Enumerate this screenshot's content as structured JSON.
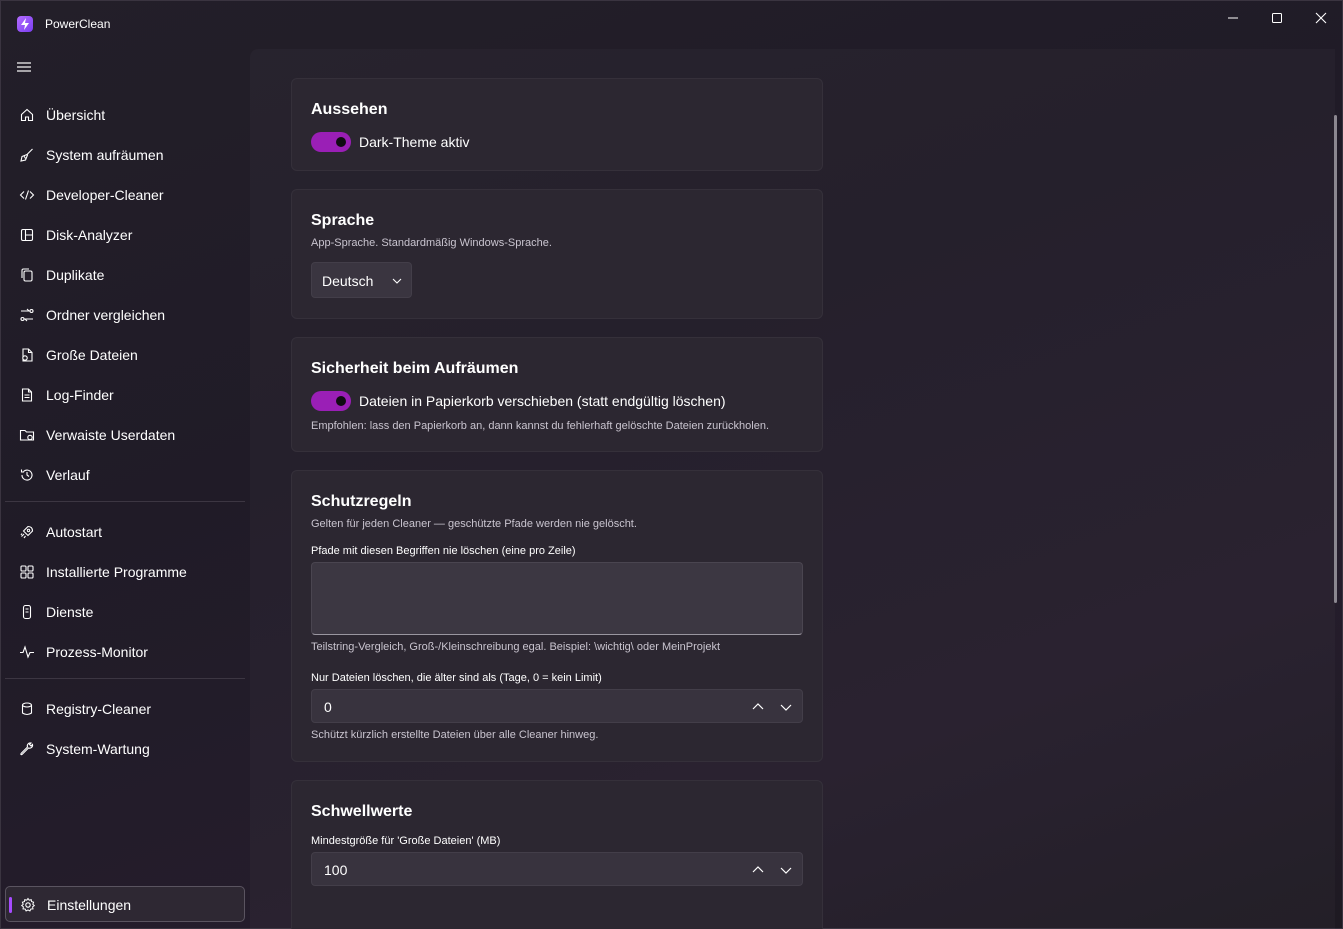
{
  "app": {
    "title": "PowerClean"
  },
  "window_controls": [
    "minimize-icon",
    "maximize-icon",
    "close-icon"
  ],
  "sidebar": {
    "menu_icon": "hamburger-icon",
    "groups": [
      [
        {
          "label": "Übersicht",
          "icon": "home-icon"
        },
        {
          "label": "System aufräumen",
          "icon": "broom-icon"
        },
        {
          "label": "Developer-Cleaner",
          "icon": "code-icon"
        },
        {
          "label": "Disk-Analyzer",
          "icon": "disk-layout-icon"
        },
        {
          "label": "Duplikate",
          "icon": "copy-icon"
        },
        {
          "label": "Ordner vergleichen",
          "icon": "compare-icon"
        },
        {
          "label": "Große Dateien",
          "icon": "large-file-icon"
        },
        {
          "label": "Log-Finder",
          "icon": "document-icon"
        },
        {
          "label": "Verwaiste Userdaten",
          "icon": "folder-icon"
        },
        {
          "label": "Verlauf",
          "icon": "history-icon"
        }
      ],
      [
        {
          "label": "Autostart",
          "icon": "rocket-icon"
        },
        {
          "label": "Installierte Programme",
          "icon": "apps-icon"
        },
        {
          "label": "Dienste",
          "icon": "service-icon"
        },
        {
          "label": "Prozess-Monitor",
          "icon": "pulse-icon"
        }
      ],
      [
        {
          "label": "Registry-Cleaner",
          "icon": "database-icon"
        },
        {
          "label": "System-Wartung",
          "icon": "wrench-icon"
        }
      ]
    ],
    "footer": {
      "label": "Einstellungen",
      "icon": "gear-icon",
      "selected": true
    }
  },
  "settings": {
    "appearance": {
      "title": "Aussehen",
      "dark_theme_label": "Dark-Theme aktiv",
      "dark_theme_on": true
    },
    "language": {
      "title": "Sprache",
      "subtitle": "App-Sprache. Standardmäßig Windows-Sprache.",
      "selected": "Deutsch"
    },
    "safety": {
      "title": "Sicherheit beim Aufräumen",
      "recycle_label": "Dateien in Papierkorb verschieben (statt endgültig löschen)",
      "recycle_on": true,
      "hint": "Empfohlen: lass den Papierkorb an, dann kannst du fehlerhaft gelöschte Dateien zurückholen."
    },
    "protection": {
      "title": "Schutzregeln",
      "subtitle": "Gelten für jeden Cleaner — geschützte Pfade werden nie gelöscht.",
      "paths_label": "Pfade mit diesen Begriffen nie löschen (eine pro Zeile)",
      "paths_value": "",
      "paths_hint": "Teilstring-Vergleich, Groß-/Kleinschreibung egal. Beispiel: \\wichtig\\ oder MeinProjekt",
      "age_label": "Nur Dateien löschen, die älter sind als (Tage, 0 = kein Limit)",
      "age_value": "0",
      "age_hint": "Schützt kürzlich erstellte Dateien über alle Cleaner hinweg."
    },
    "thresholds": {
      "title": "Schwellwerte",
      "min_size_label": "Mindestgröße für 'Große Dateien' (MB)",
      "min_size_value": "100"
    }
  },
  "colors": {
    "accent": "#9a1fb6",
    "selection_indicator": "#a64bff"
  }
}
